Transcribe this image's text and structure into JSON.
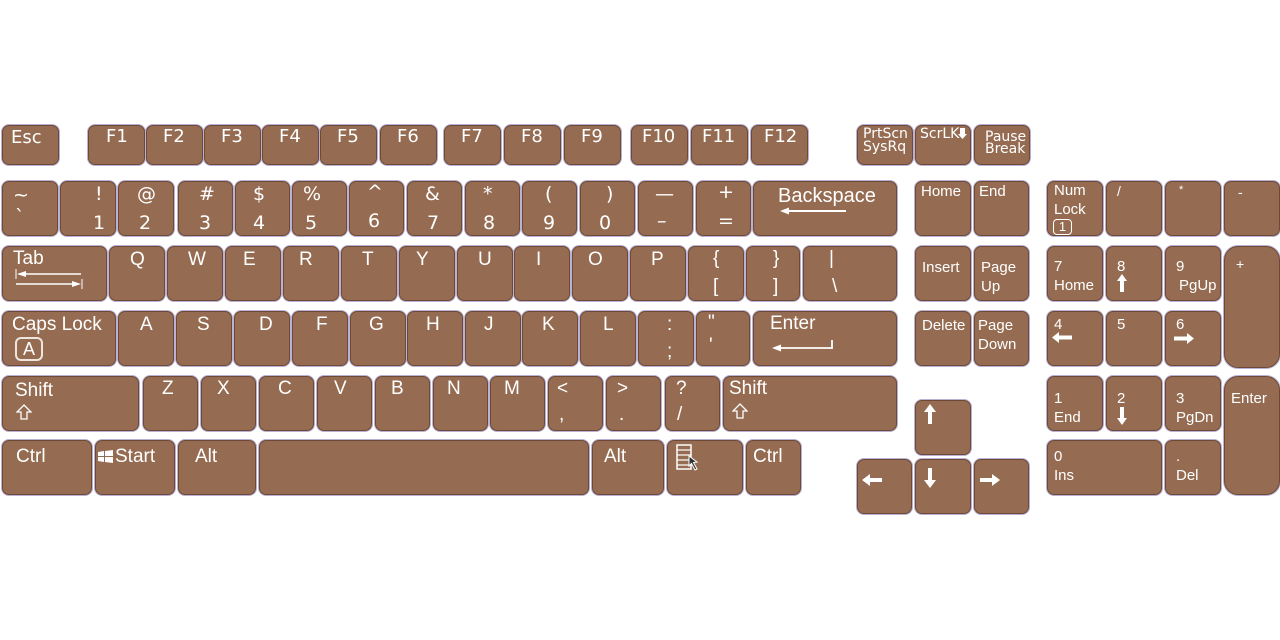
{
  "keyboard": {
    "colors": {
      "key_fill": "#956c52",
      "key_border": "#6e4a36",
      "key_glow": "#b9b2d6",
      "legend": "#ffffff",
      "background": "#ffffff"
    },
    "function_row": {
      "esc": "Esc",
      "f_keys": [
        "F1",
        "F2",
        "F3",
        "F4",
        "F5",
        "F6",
        "F7",
        "F8",
        "F9",
        "F10",
        "F11",
        "F12"
      ],
      "prtscn": {
        "top": "PrtScn",
        "bottom": "SysRq"
      },
      "scrlk": {
        "label": "ScrLK",
        "icon": "lock-down-icon"
      },
      "pause": {
        "top": "Pause",
        "bottom": "Break"
      }
    },
    "number_row": [
      {
        "shift": "~",
        "base": "`"
      },
      {
        "shift": "!",
        "base": "1"
      },
      {
        "shift": "@",
        "base": "2"
      },
      {
        "shift": "#",
        "base": "3"
      },
      {
        "shift": "$",
        "base": "4"
      },
      {
        "shift": "%",
        "base": "5"
      },
      {
        "shift": "^",
        "base": "6"
      },
      {
        "shift": "&",
        "base": "7"
      },
      {
        "shift": "*",
        "base": "8"
      },
      {
        "shift": "(",
        "base": "9"
      },
      {
        "shift": ")",
        "base": "0"
      },
      {
        "shift": "—",
        "base": "–"
      },
      {
        "shift": "+",
        "base": "="
      }
    ],
    "backspace": "Backspace",
    "tab": "Tab",
    "qwerty_row": [
      "Q",
      "W",
      "E",
      "R",
      "T",
      "Y",
      "U",
      "I",
      "O",
      "P"
    ],
    "bracket_keys": [
      {
        "shift": "{",
        "base": "["
      },
      {
        "shift": "}",
        "base": "]"
      },
      {
        "shift": "|",
        "base": "\\"
      }
    ],
    "caps_lock": {
      "label": "Caps Lock",
      "indicator": "A"
    },
    "home_row": [
      "A",
      "S",
      "D",
      "F",
      "G",
      "H",
      "J",
      "K",
      "L"
    ],
    "home_punct": [
      {
        "shift": ":",
        "base": ";"
      },
      {
        "shift": "\"",
        "base": "'"
      }
    ],
    "enter": "Enter",
    "shift_label": "Shift",
    "bottom_letters": [
      "Z",
      "X",
      "C",
      "V",
      "B",
      "N",
      "M"
    ],
    "bottom_punct": [
      {
        "shift": "<",
        "base": ","
      },
      {
        "shift": ">",
        "base": "."
      },
      {
        "shift": "?",
        "base": "/"
      }
    ],
    "ctrl": "Ctrl",
    "start": "Start",
    "alt": "Alt",
    "nav_cluster": {
      "home": "Home",
      "end": "End",
      "insert": "Insert",
      "page_up": [
        "Page",
        "Up"
      ],
      "delete": "Delete",
      "page_down": [
        "Page",
        "Down"
      ]
    },
    "numpad": {
      "numlock": [
        "Num",
        "Lock"
      ],
      "numlock_indicator": "1",
      "divide": "/",
      "multiply": "*",
      "minus": "-",
      "plus": "+",
      "k7": [
        "7",
        "Home"
      ],
      "k8": "8",
      "k9": [
        "9",
        "PgUp"
      ],
      "k4": "4",
      "k5": "5",
      "k6": "6",
      "k1": [
        "1",
        "End"
      ],
      "k2": "2",
      "k3": [
        "3",
        "PgDn"
      ],
      "k0": [
        "0",
        "Ins"
      ],
      "kdot": [
        ".",
        "Del"
      ],
      "enter": "Enter"
    }
  }
}
